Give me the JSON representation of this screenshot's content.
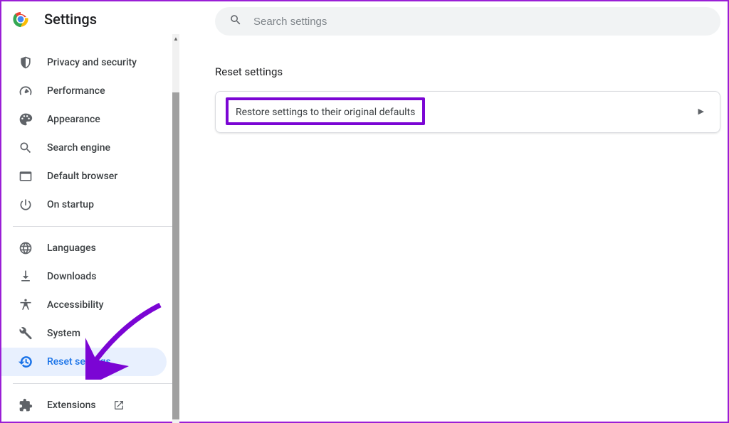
{
  "header": {
    "title": "Settings"
  },
  "search": {
    "placeholder": "Search settings"
  },
  "sidebar": {
    "group1": [
      {
        "id": "privacy",
        "label": "Privacy and security"
      },
      {
        "id": "performance",
        "label": "Performance"
      },
      {
        "id": "appearance",
        "label": "Appearance"
      },
      {
        "id": "search-engine",
        "label": "Search engine"
      },
      {
        "id": "default-browser",
        "label": "Default browser"
      },
      {
        "id": "on-startup",
        "label": "On startup"
      }
    ],
    "group2": [
      {
        "id": "languages",
        "label": "Languages"
      },
      {
        "id": "downloads",
        "label": "Downloads"
      },
      {
        "id": "accessibility",
        "label": "Accessibility"
      },
      {
        "id": "system",
        "label": "System"
      },
      {
        "id": "reset",
        "label": "Reset settings",
        "active": true
      }
    ],
    "group3": [
      {
        "id": "extensions",
        "label": "Extensions"
      }
    ]
  },
  "main": {
    "section_title": "Reset settings",
    "restore_label": "Restore settings to their original defaults"
  },
  "annotation": {
    "highlight_color": "#7b05d4"
  }
}
